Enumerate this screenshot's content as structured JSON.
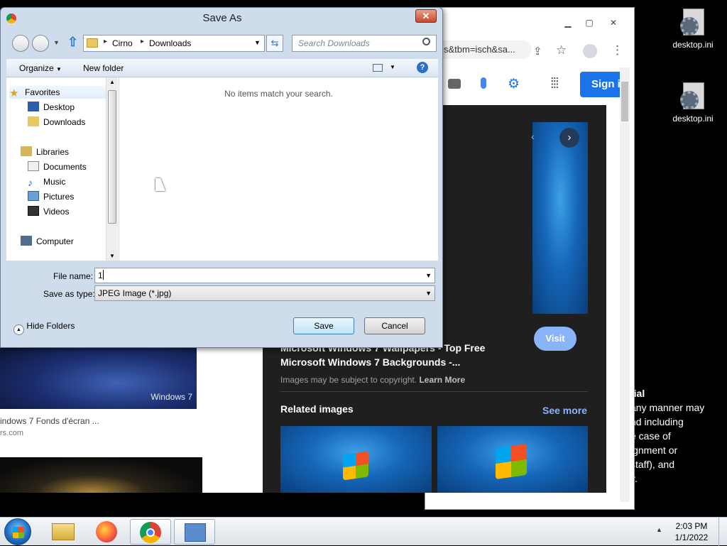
{
  "desktop": {
    "icons": [
      {
        "label": "desktop.ini"
      },
      {
        "label": "desktop.ini"
      }
    ]
  },
  "chrome": {
    "address_fragment": "s&tbm=isch&sa...",
    "sign_in": "Sign i",
    "result": {
      "title_line1": "Microsoft Windows 7 Wallpapers - Top Free",
      "title_line2": "Microsoft Windows 7 Backgrounds -...",
      "copyright": "Images may be subject to copyright.",
      "learn_more": "Learn More",
      "visit": "Visit"
    },
    "related": {
      "title": "Related images",
      "see_more": "See more"
    },
    "left_result": {
      "caption": "indows 7 Fonds d'écran ...",
      "source": "rs.com",
      "thumb_label": "Windows 7"
    },
    "right_text": [
      "tial",
      "any manner may",
      "nd including",
      "e case of",
      "ignment or",
      "staff), and",
      "y."
    ]
  },
  "dialog": {
    "title": "Save As",
    "close": "✕",
    "breadcrumb": [
      "Cirno",
      "Downloads"
    ],
    "search_placeholder": "Search Downloads",
    "organize": "Organize",
    "new_folder": "New folder",
    "empty_message": "No items match your search.",
    "nav": {
      "favorites": "Favorites",
      "desktop": "Desktop",
      "downloads": "Downloads",
      "libraries": "Libraries",
      "documents": "Documents",
      "music": "Music",
      "pictures": "Pictures",
      "videos": "Videos",
      "computer": "Computer"
    },
    "file_name_label": "File name:",
    "file_name_value": "1",
    "save_type_label": "Save as type:",
    "save_type_value": "JPEG Image (*.jpg)",
    "hide_folders": "Hide Folders",
    "save": "Save",
    "cancel": "Cancel"
  },
  "taskbar": {
    "time": "2:03 PM",
    "date": "1/1/2022"
  }
}
